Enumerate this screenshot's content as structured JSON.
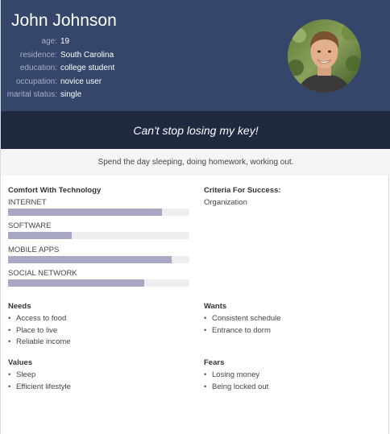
{
  "persona": {
    "name": "John Johnson",
    "details": [
      {
        "key": "age:",
        "value": "19"
      },
      {
        "key": "residence:",
        "value": "South Carolina"
      },
      {
        "key": "education:",
        "value": "college student"
      },
      {
        "key": "occupation:",
        "value": "novice user"
      },
      {
        "key": "marital status:",
        "value": "single"
      }
    ],
    "photo_icon": "avatar-photo",
    "quote": "Can't stop losing my key!",
    "bio": "Spend the day sleeping, doing homework, working out."
  },
  "comfort": {
    "title": "Comfort With Technology",
    "items": [
      {
        "label": "INTERNET",
        "level": 0.85
      },
      {
        "label": "SOFTWARE",
        "level": 0.35
      },
      {
        "label": "MOBILE APPS",
        "level": 0.9
      },
      {
        "label": "SOCIAL NETWORK",
        "level": 0.75
      }
    ],
    "bar_color": "#a8a8c5"
  },
  "criteria": {
    "title": "Criteria For Success:",
    "value": "Organization"
  },
  "needs": {
    "title": "Needs",
    "items": [
      "Access to food",
      "Place to live",
      "Reliable income"
    ]
  },
  "wants": {
    "title": "Wants",
    "items": [
      "Consistent schedule",
      "Entrance to dorm"
    ]
  },
  "values": {
    "title": "Values",
    "items": [
      "Sleep",
      "Efficient lifestyle"
    ]
  },
  "fears": {
    "title": "Fears",
    "items": [
      "Losing money",
      "Being locked out"
    ]
  },
  "colors": {
    "header": "#34466a",
    "quote_bar": "#1f2a41",
    "bio_bar": "#f5f5f5"
  }
}
